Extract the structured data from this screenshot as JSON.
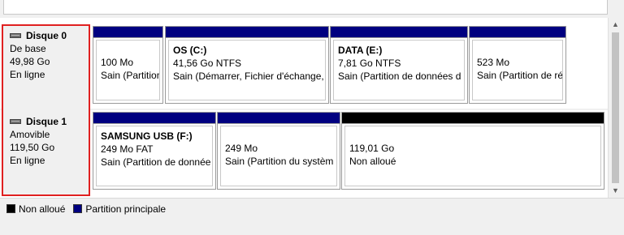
{
  "colors": {
    "primary_partition": "#000080",
    "unallocated": "#000000",
    "highlight_box": "#e02020"
  },
  "disks": [
    {
      "title": "Disque 0",
      "type": "De base",
      "size": "49,98 Go",
      "status": "En ligne",
      "partitions": [
        {
          "name": "",
          "size": "100 Mo",
          "status": "Sain (Partition"
        },
        {
          "name": "OS  (C:)",
          "size": "41,56 Go NTFS",
          "status": "Sain (Démarrer, Fichier d'échange,"
        },
        {
          "name": "DATA  (E:)",
          "size": "7,81 Go NTFS",
          "status": "Sain (Partition de données d"
        },
        {
          "name": "",
          "size": "523 Mo",
          "status": "Sain (Partition de ré"
        }
      ]
    },
    {
      "title": "Disque 1",
      "type": "Amovible",
      "size": "119,50 Go",
      "status": "En ligne",
      "partitions": [
        {
          "name": "SAMSUNG USB  (F:)",
          "size": "249 Mo FAT",
          "status": "Sain (Partition de donnée"
        },
        {
          "name": "",
          "size": "249 Mo",
          "status": "Sain (Partition du systèm"
        },
        {
          "name": "",
          "size": "119,01 Go",
          "status": "Non alloué"
        }
      ]
    }
  ],
  "legend": {
    "unallocated_label": "Non alloué",
    "primary_label": "Partition principale"
  },
  "icons": {
    "disk": "hard-drive-icon",
    "scroll_up": "scroll-up-arrow-icon",
    "scroll_down": "scroll-down-arrow-icon"
  }
}
